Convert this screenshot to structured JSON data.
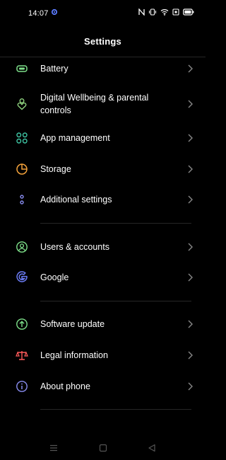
{
  "status_bar": {
    "time": "14:07",
    "icons": [
      "gear-icon",
      "nfc-icon",
      "vibrate-icon",
      "wifi-icon",
      "sim-icon",
      "battery-icon"
    ]
  },
  "header": {
    "title": "Settings"
  },
  "items": [
    {
      "label": "Battery",
      "icon": "battery-icon",
      "color": "#7ee08a"
    },
    {
      "label": "Digital Wellbeing & parental controls",
      "icon": "wellbeing-icon",
      "color": "#8fd37f"
    },
    {
      "label": "App management",
      "icon": "apps-icon",
      "color": "#3fc7a5"
    },
    {
      "label": "Storage",
      "icon": "storage-icon",
      "color": "#f5a33b"
    },
    {
      "label": "Additional settings",
      "icon": "additional-icon",
      "color": "#8a8ef2"
    },
    {
      "label": "Users & accounts",
      "icon": "user-icon",
      "color": "#7ee08a"
    },
    {
      "label": "Google",
      "icon": "google-icon",
      "color": "#6b7cf5"
    },
    {
      "label": "Software update",
      "icon": "update-icon",
      "color": "#7ee08a"
    },
    {
      "label": "Legal information",
      "icon": "legal-icon",
      "color": "#ff5a5a"
    },
    {
      "label": "About phone",
      "icon": "info-icon",
      "color": "#8a8ef2"
    }
  ],
  "nav_bar": {
    "buttons": [
      "menu-icon",
      "home-icon",
      "back-icon"
    ]
  }
}
